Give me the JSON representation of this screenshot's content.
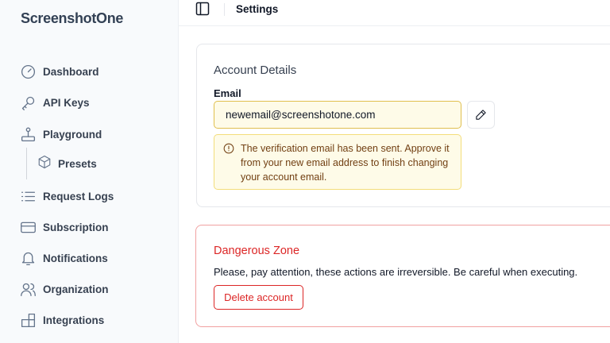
{
  "brand": "ScreenshotOne",
  "header": {
    "title": "Settings"
  },
  "sidebar": {
    "items": [
      {
        "label": "Dashboard",
        "icon": "gauge-icon"
      },
      {
        "label": "API Keys",
        "icon": "key-icon"
      },
      {
        "label": "Playground",
        "icon": "joystick-icon"
      },
      {
        "label": "Presets",
        "icon": "cube-icon"
      },
      {
        "label": "Request Logs",
        "icon": "list-icon"
      },
      {
        "label": "Subscription",
        "icon": "credit-card-icon"
      },
      {
        "label": "Notifications",
        "icon": "bell-icon"
      },
      {
        "label": "Organization",
        "icon": "users-icon"
      },
      {
        "label": "Integrations",
        "icon": "puzzle-icon"
      }
    ]
  },
  "account": {
    "title": "Account Details",
    "email_label": "Email",
    "email_value": "newemail@screenshotone.com",
    "alert_message": "The verification email has been sent. Approve it from your new email address to finish changing your account email."
  },
  "danger": {
    "title": "Dangerous Zone",
    "message": "Please, pay attention, these actions are irreversible. Be careful when executing.",
    "delete_label": "Delete account"
  },
  "colors": {
    "danger": "#dc2626",
    "alert_bg": "#fefbe8",
    "alert_text": "#713f12",
    "input_border": "#e0bf4e"
  }
}
